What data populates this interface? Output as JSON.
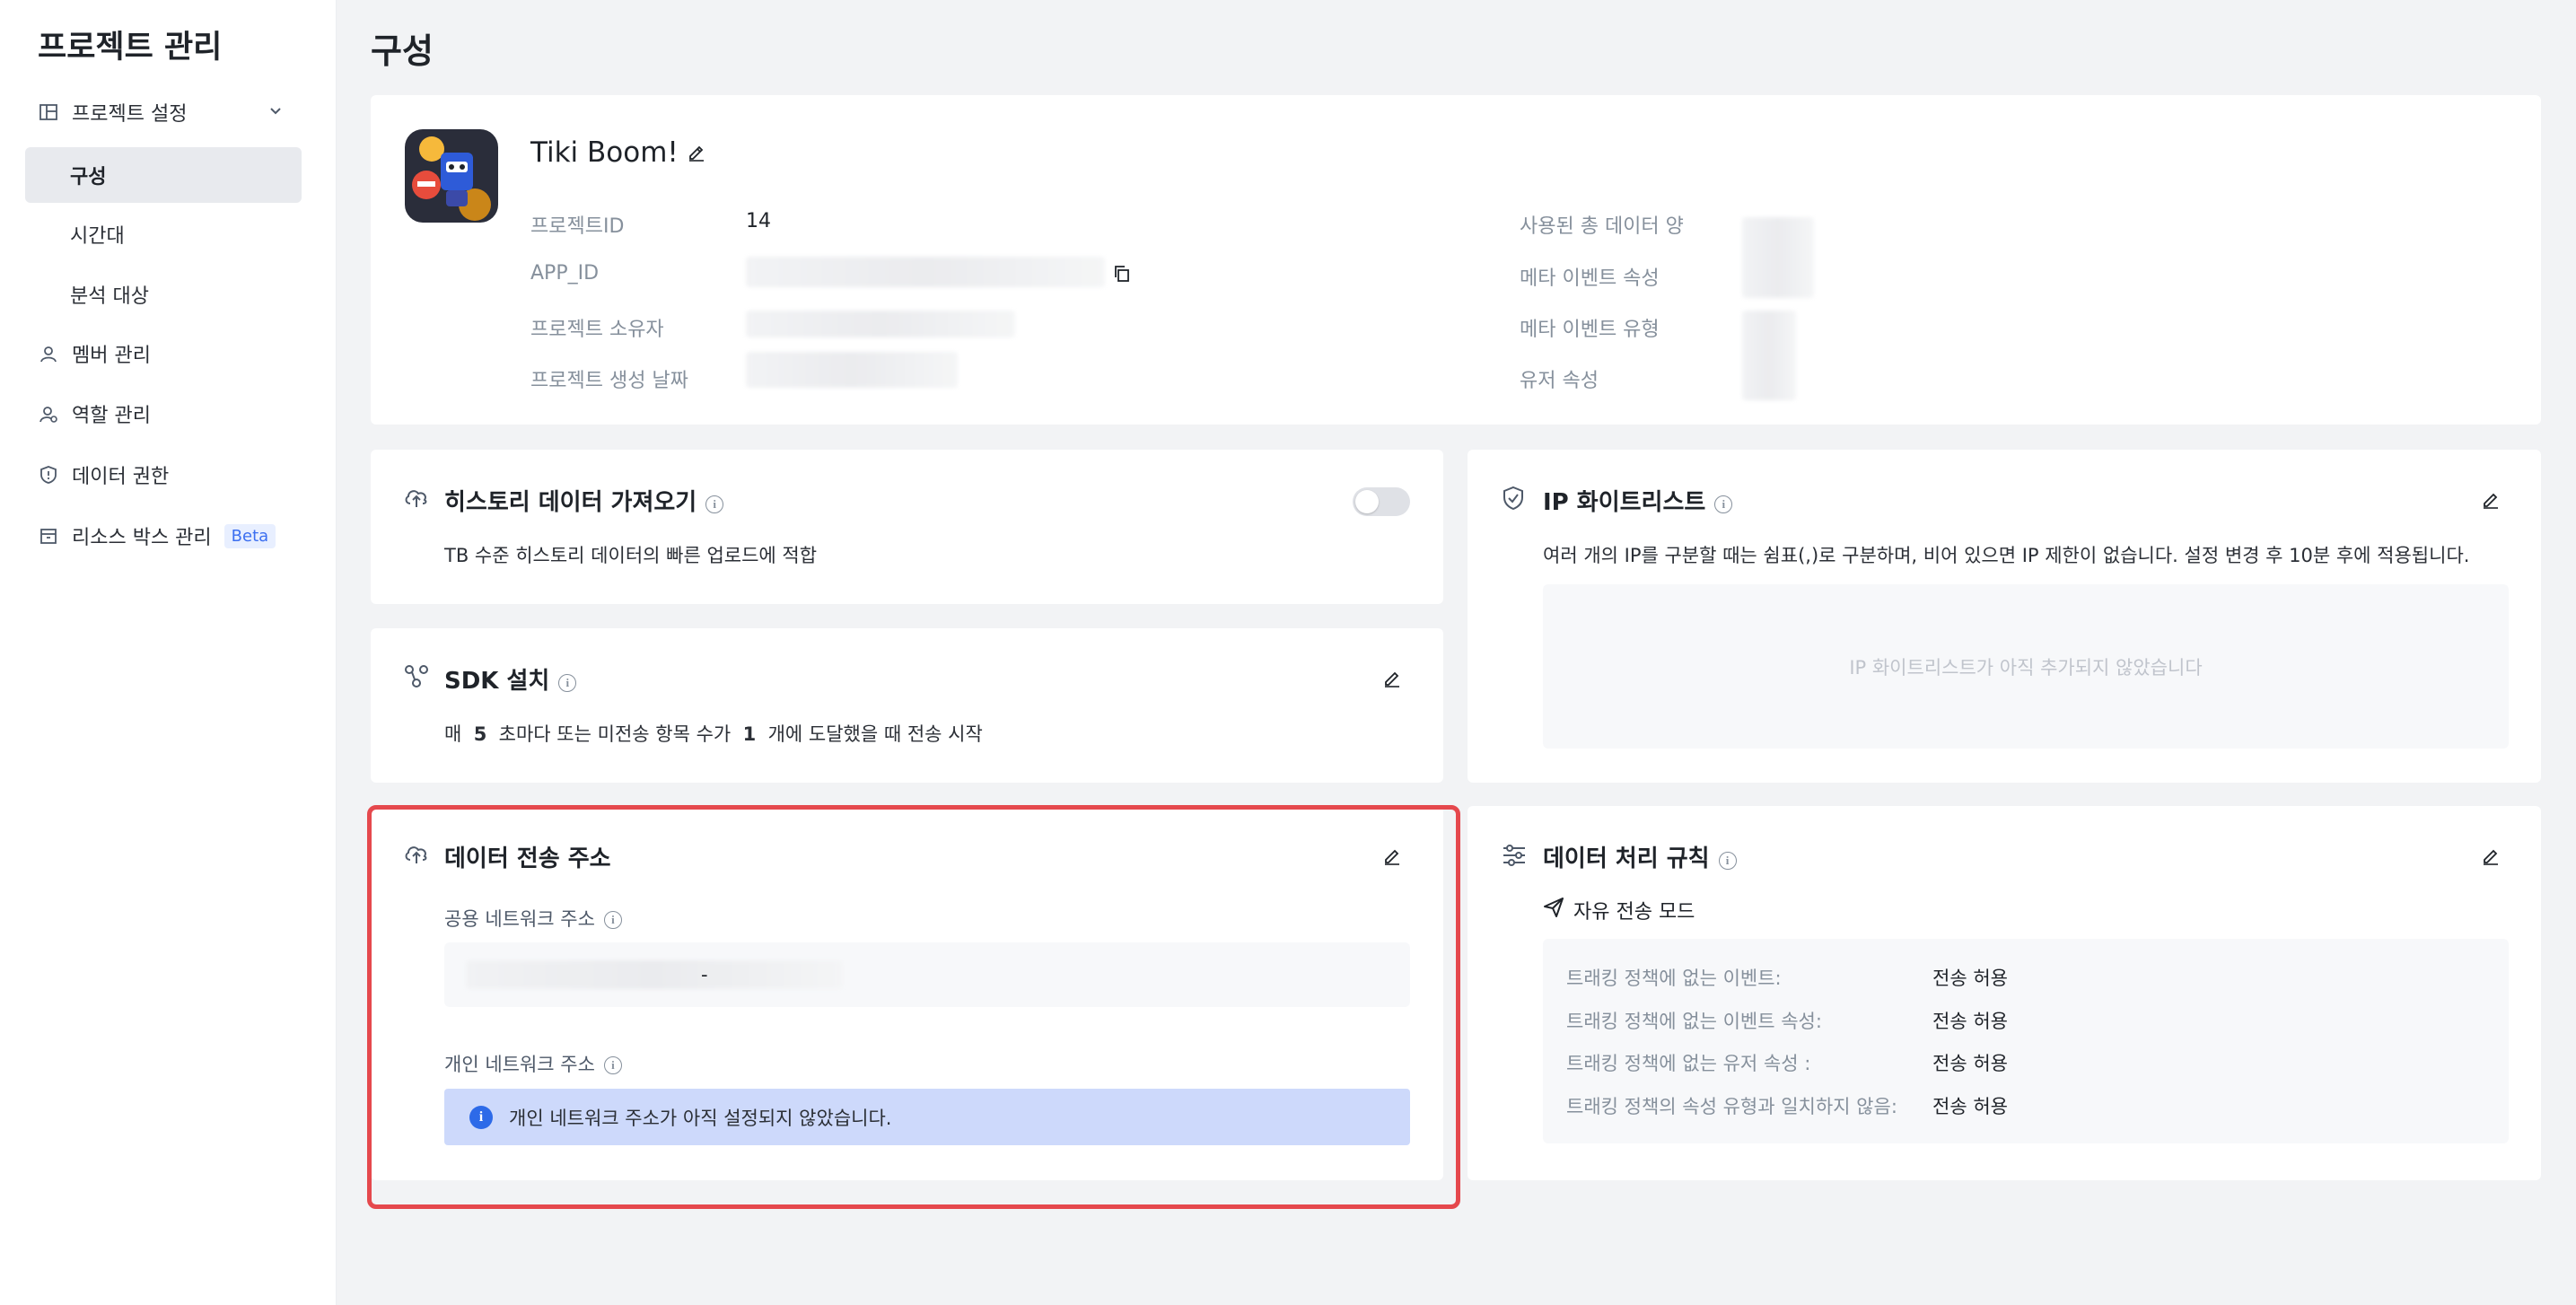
{
  "sidebar": {
    "title": "프로젝트 관리",
    "items": [
      {
        "label": "프로젝트 설정",
        "icon": "layout-icon"
      },
      {
        "label": "구성"
      },
      {
        "label": "시간대"
      },
      {
        "label": "분석 대상"
      },
      {
        "label": "멤버 관리",
        "icon": "user-icon"
      },
      {
        "label": "역할 관리",
        "icon": "user-role-icon"
      },
      {
        "label": "데이터 권한",
        "icon": "shield-icon"
      },
      {
        "label": "리소스 박스 관리",
        "icon": "box-icon",
        "badge": "Beta"
      }
    ]
  },
  "page": {
    "title": "구성"
  },
  "project": {
    "name": "Tiki Boom!",
    "labels": {
      "id": "프로젝트ID",
      "app_id": "APP_ID",
      "owner": "프로젝트 소유자",
      "created": "프로젝트 생성 날짜",
      "data_used": "사용된 총 데이터 양",
      "meta_event_props": "메타 이벤트 속성",
      "meta_event_types": "메타 이벤트 유형",
      "user_props": "유저 속성"
    },
    "id_value": "14"
  },
  "history": {
    "title": "히스토리 데이터 가져오기",
    "desc": "TB 수준 히스토리 데이터의 빠른 업로드에 적합",
    "enabled": false
  },
  "sdk": {
    "title": "SDK 설치",
    "desc_prefix": "매",
    "seconds": "5",
    "desc_mid": "초마다 또는 미전송 항목 수가",
    "count": "1",
    "desc_suffix": "개에 도달했을 때 전송 시작"
  },
  "endpoint": {
    "title": "데이터 전송 주소",
    "public_label": "공용 네트워크 주소",
    "public_dash": "-",
    "private_label": "개인 네트워크 주소",
    "private_notice": "개인 네트워크 주소가 아직 설정되지 않았습니다."
  },
  "ip": {
    "title": "IP 화이트리스트",
    "desc": "여러 개의 IP를 구분할 때는 쉼표(,)로 구분하며, 비어 있으면 IP 제한이 없습니다. 설정 변경 후 10분 후에 적용됩니다.",
    "empty": "IP 화이트리스트가 아직 추가되지 않았습니다"
  },
  "rules": {
    "title": "데이터 처리 규칙",
    "mode": "자유 전송 모드",
    "items": [
      {
        "label": "트래킹 정책에 없는 이벤트:",
        "value": "전송 허용"
      },
      {
        "label": "트래킹 정책에 없는 이벤트 속성:",
        "value": "전송 허용"
      },
      {
        "label": "트래킹 정책에 없는 유저 속성 :",
        "value": "전송 허용"
      },
      {
        "label": "트래킹 정책의 속성 유형과 일치하지 않음:",
        "value": "전송 허용"
      }
    ]
  },
  "colors": {
    "accent": "#2d6ae8",
    "highlight": "#e5484d",
    "notice_bg": "#cdd9fb"
  }
}
